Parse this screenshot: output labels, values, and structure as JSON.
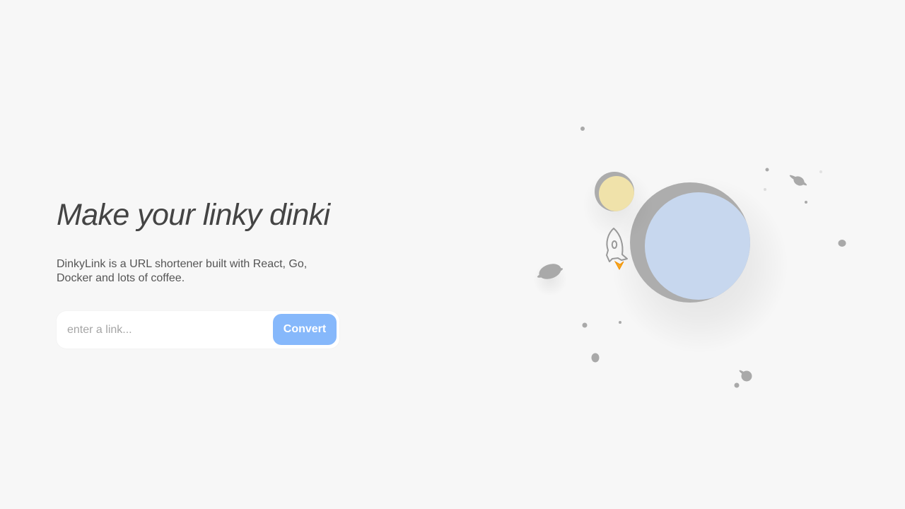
{
  "hero": {
    "headline": "Make your linky dinki",
    "tagline": "DinkyLink is a URL shortener built with React, Go, Docker and lots of coffee."
  },
  "form": {
    "input_placeholder": "enter a link...",
    "input_value": "",
    "button_label": "Convert"
  },
  "colors": {
    "background": "#f7f7f7",
    "accent": "#86b8fb",
    "planet": "#c7d7ee",
    "moon": "#f0e2aa",
    "rocket_flame": "#f5a623"
  },
  "icons": {
    "illustration": "space-illustration",
    "rocket": "rocket-icon"
  }
}
